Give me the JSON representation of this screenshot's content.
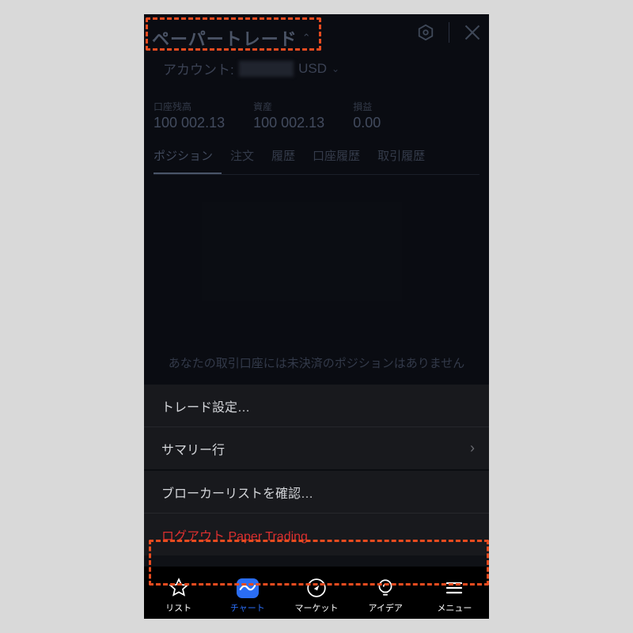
{
  "header": {
    "title": "ペーパートレード",
    "settings_icon": "settings-hex",
    "close_icon": "close"
  },
  "account": {
    "label": "アカウント:",
    "id_masked": "■■■■■",
    "currency": "USD"
  },
  "stats": [
    {
      "label": "口座残高",
      "value": "100 002.13"
    },
    {
      "label": "資産",
      "value": "100 002.13"
    },
    {
      "label": "損益",
      "value": "0.00"
    }
  ],
  "tabs": {
    "items": [
      "ポジション",
      "注文",
      "履歴",
      "口座履歴",
      "取引履歴"
    ],
    "active_index": 0
  },
  "empty_message": "あなたの取引口座には未決済のポジションはありません",
  "menu": {
    "trade_settings": "トレード設定…",
    "summary_row": "サマリー行",
    "broker_list": "ブローカーリストを確認…",
    "logout": "ログアウト Paper Trading"
  },
  "nav": {
    "items": [
      {
        "key": "list",
        "label": "リスト"
      },
      {
        "key": "chart",
        "label": "チャート"
      },
      {
        "key": "market",
        "label": "マーケット"
      },
      {
        "key": "idea",
        "label": "アイデア"
      },
      {
        "key": "menu",
        "label": "メニュー"
      }
    ],
    "active_key": "chart"
  },
  "highlights": [
    "header-title",
    "logout-row"
  ]
}
